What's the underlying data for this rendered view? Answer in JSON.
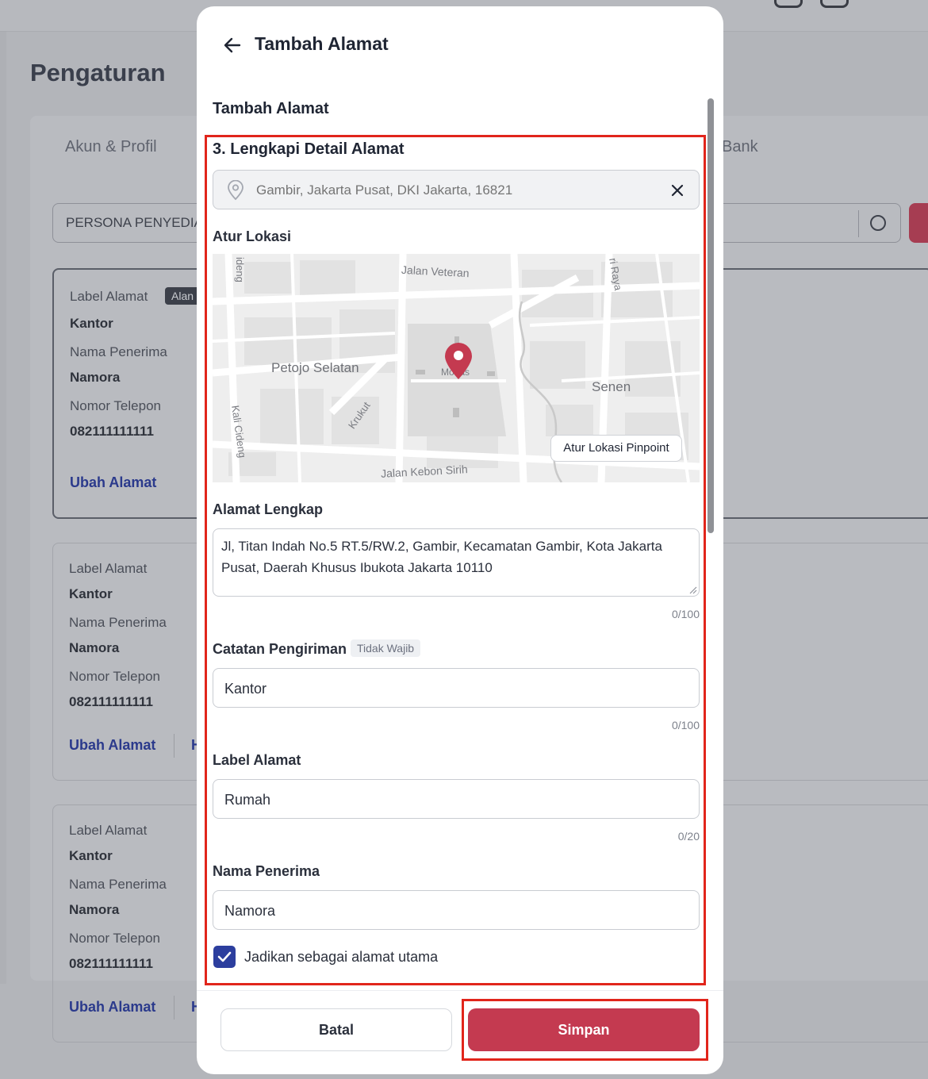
{
  "background": {
    "page_title": "Pengaturan",
    "tabs": [
      "Akun & Profil",
      "Bank"
    ],
    "search_value": "PERSONA PENYEDIA",
    "address_cards": [
      {
        "label_title": "Label Alamat",
        "tag": "Alan",
        "label_value": "Kantor",
        "recipient_title": "Nama Penerima",
        "recipient_value": "Namora",
        "phone_title": "Nomor Telepon",
        "phone_value": "082111111111",
        "edit_link": "Ubah Alamat",
        "extra_link": ""
      },
      {
        "label_title": "Label Alamat",
        "label_value": "Kantor",
        "recipient_title": "Nama Penerima",
        "recipient_value": "Namora",
        "phone_title": "Nomor Telepon",
        "phone_value": "082111111111",
        "edit_link": "Ubah Alamat",
        "extra_link": "H"
      },
      {
        "label_title": "Label Alamat",
        "label_value": "Kantor",
        "recipient_title": "Nama Penerima",
        "recipient_value": "Namora",
        "phone_title": "Nomor Telepon",
        "phone_value": "082111111111",
        "edit_link": "Ubah Alamat",
        "extra_link": "H"
      }
    ]
  },
  "modal": {
    "title": "Tambah Alamat",
    "section_title": "Tambah Alamat",
    "step_title": "3. Lengkapi Detail Alamat",
    "location_placeholder": "Gambir, Jakarta Pusat, DKI Jakarta, 16821",
    "map": {
      "label": "Atur Lokasi",
      "pinpoint_button": "Atur Lokasi Pinpoint",
      "places": {
        "petojo": "Petojo Selatan",
        "senen": "Senen",
        "monas": "Monas"
      },
      "streets": {
        "veteran": "Jalan Veteran",
        "kebon_sirih": "Jalan Kebon Sirih",
        "kali_cideng": "Kali Cideng",
        "krukut": "Krukut",
        "raya": "ri Raya",
        "cideng": "ideng"
      }
    },
    "full_address": {
      "label": "Alamat Lengkap",
      "value": "Jl, Titan Indah No.5 RT.5/RW.2, Gambir, Kecamatan Gambir, Kota Jakarta Pusat, Daerah Khusus Ibukota Jakarta 10110",
      "counter": "0/100"
    },
    "delivery_note": {
      "label": "Catatan Pengiriman",
      "optional": "Tidak Wajib",
      "value": "Kantor",
      "counter": "0/100"
    },
    "address_label": {
      "label": "Label Alamat",
      "value": "Rumah",
      "counter": "0/20"
    },
    "recipient": {
      "label": "Nama Penerima",
      "value": "Namora"
    },
    "primary_checkbox": {
      "label": "Jadikan sebagai alamat utama",
      "checked": true
    },
    "buttons": {
      "cancel": "Batal",
      "save": "Simpan"
    }
  },
  "colors": {
    "primary": "#c43a50",
    "checkbox": "#2c3e9e",
    "highlight": "#e1251b",
    "link": "#2b3a8c"
  }
}
